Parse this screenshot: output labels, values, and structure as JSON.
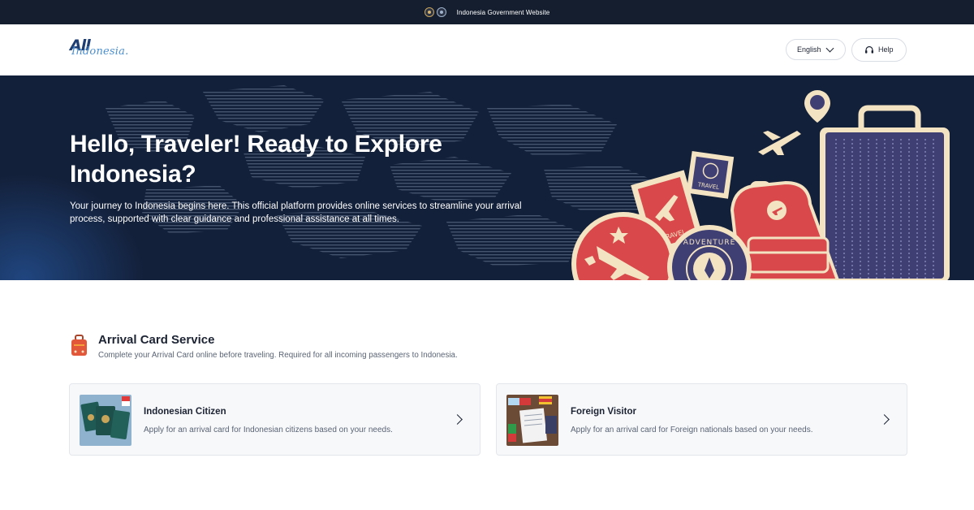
{
  "gov_bar": {
    "text": "Indonesia Government Website"
  },
  "header": {
    "logo": {
      "primary": "All",
      "secondary": "Indonesia."
    },
    "language_label": "English",
    "help_label": "Help"
  },
  "hero": {
    "title": "Hello, Traveler! Ready to Explore Indonesia?",
    "description": "Your journey to Indonesia begins here. This official platform provides online services to streamline your arrival process, supported with clear guidance and professional assistance at all times.",
    "stamp_travel_1": "TRAVEL",
    "stamp_travel_2": "TRAVEL",
    "stamp_adventure": "ADVENTURE"
  },
  "section": {
    "title": "Arrival Card Service",
    "subtitle": "Complete your Arrival Card online before traveling. Required for all incoming passengers to Indonesia."
  },
  "cards": [
    {
      "title": "Indonesian Citizen",
      "description": "Apply for an arrival card for Indonesian citizens based on your needs."
    },
    {
      "title": "Foreign Visitor",
      "description": "Apply for an arrival card for Foreign nationals based on your needs."
    }
  ],
  "colors": {
    "gov_bar": "#151e2e",
    "hero_bg": "#13203a",
    "accent_red": "#d9484a",
    "accent_cream": "#f3e3c3",
    "accent_purple": "#3f3f74"
  }
}
